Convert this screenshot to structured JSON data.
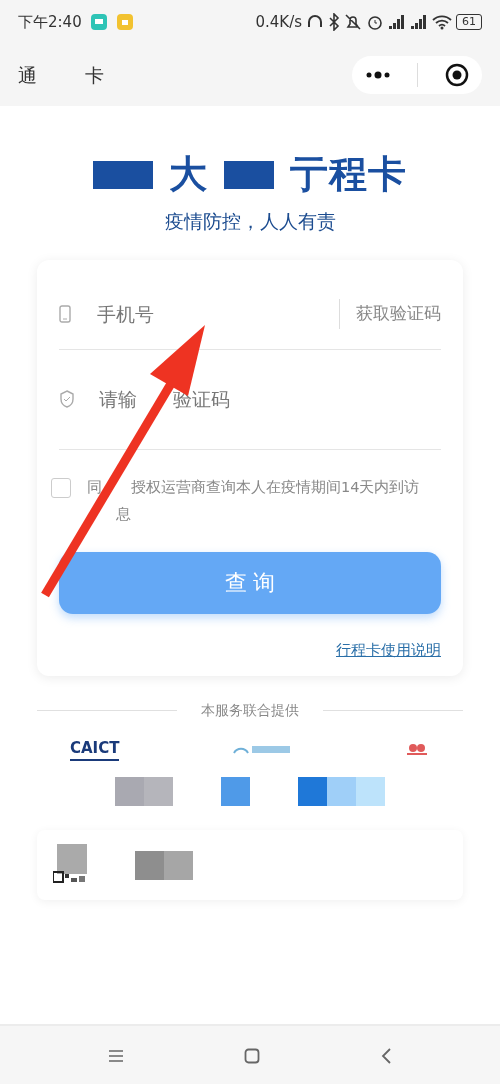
{
  "status_bar": {
    "time": "下午2:40",
    "speed": "0.4K/s",
    "battery": "61"
  },
  "nav": {
    "title_parts": [
      "通",
      "卡"
    ]
  },
  "banner": {
    "title_parts": [
      "大",
      "亍程卡"
    ],
    "slogan": "疫情防控，人人有责"
  },
  "form": {
    "phone": {
      "placeholder": "手机号"
    },
    "code_button": "获取验证码",
    "code": {
      "placeholder_parts": [
        "请输",
        "验证码"
      ]
    },
    "consent": {
      "lines": [
        {
          "parts": [
            "同",
            "授权运营商查询本人在疫情期间14天内到访"
          ]
        },
        {
          "covered_start": true,
          "parts": [
            "息"
          ]
        }
      ],
      "checked": false
    },
    "submit": "查 询",
    "help_link": "行程卡使用说明"
  },
  "providers": {
    "heading": "本服务联合提供",
    "logo_text": "CAICT"
  }
}
